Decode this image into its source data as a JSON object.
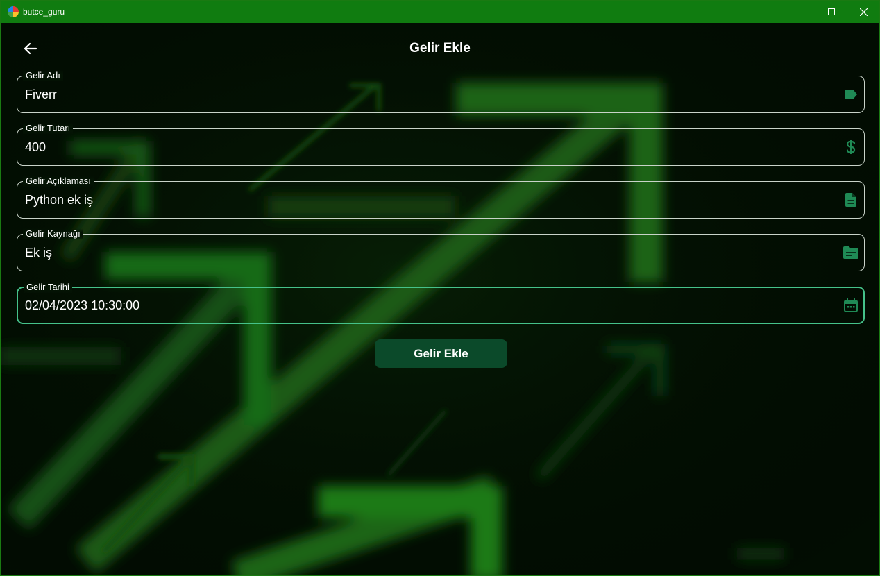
{
  "window": {
    "title": "butce_guru",
    "titlebar_color": "#107c10"
  },
  "header": {
    "title": "Gelir Ekle",
    "back_icon": "arrow-left-icon"
  },
  "form": {
    "fields": [
      {
        "label": "Gelir Adı",
        "value": "Fiverr",
        "icon": "label-tag-icon"
      },
      {
        "label": "Gelir Tutarı",
        "value": "400",
        "icon": "dollar-icon"
      },
      {
        "label": "Gelir Açıklaması",
        "value": "Python ek iş",
        "icon": "document-icon"
      },
      {
        "label": "Gelir Kaynağı",
        "value": "Ek iş",
        "icon": "folder-icon"
      },
      {
        "label": "Gelir Tarihi",
        "value": "02/04/2023 10:30:00",
        "icon": "calendar-icon",
        "focused": true
      }
    ],
    "submit_label": "Gelir Ekle"
  },
  "colors": {
    "accent": "#45c28a",
    "icon": "#1f8a55",
    "button": "#0b4a2a",
    "background": "#020d02"
  }
}
